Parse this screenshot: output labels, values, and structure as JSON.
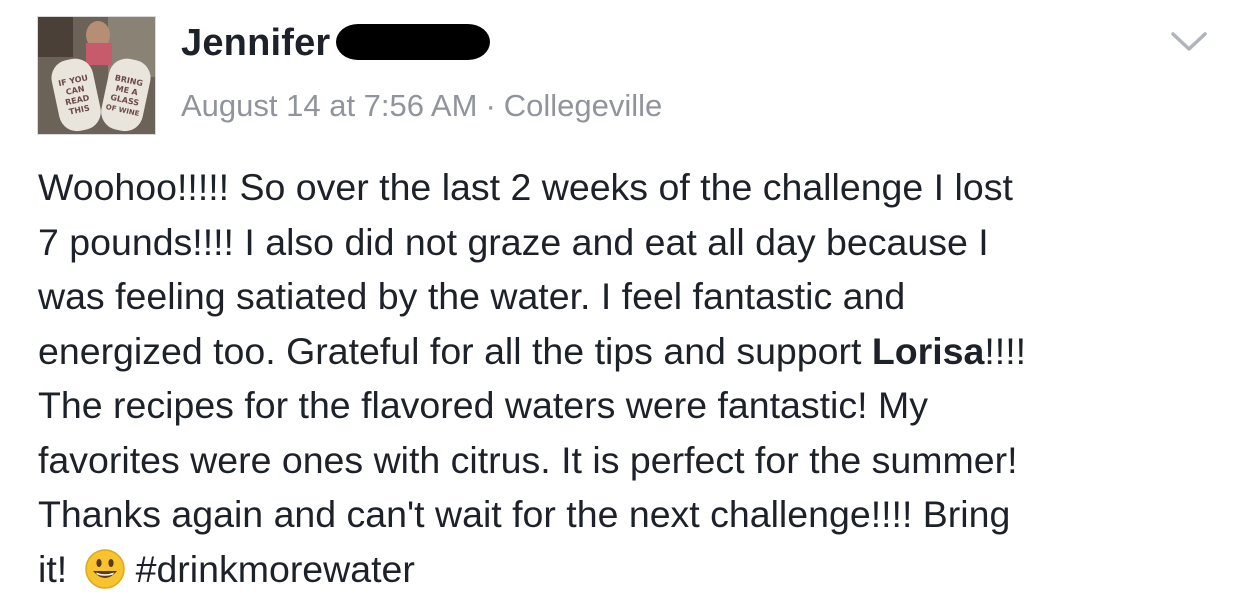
{
  "post": {
    "author_name": "Jennifer",
    "date": "August 14 at 7:56 AM",
    "separator": "·",
    "location": "Collegeville",
    "text_part1": "Woohoo!!!!!  So over the last 2 weeks of the challenge I lost\n7 pounds!!!!  I also did not graze and eat all day because I\nwas feeling satiated by the water. I feel fantastic and\nenergized too. Grateful for all the tips and support ",
    "mention": "Lorisa",
    "text_part2": "!!!!\nThe recipes for the flavored waters were fantastic!  My\nfavorites were ones with citrus. It is perfect for the summer!\nThanks again and can't wait for the next challenge!!!!  Bring\nit! ",
    "hashtag": "#drinkmorewater",
    "avatar_sock_text": [
      "IF YOU",
      "CAN",
      "READ",
      "THIS",
      "BRING",
      "ME A",
      "GLASS",
      "OF WINE"
    ]
  },
  "icons": {
    "options": "chevron-down-icon",
    "emoji": "smiling-face-icon"
  },
  "colors": {
    "text": "#1d2129",
    "meta": "#90949c",
    "chevron": "#b0b4bb",
    "emoji_fill": "#f7c32e"
  }
}
